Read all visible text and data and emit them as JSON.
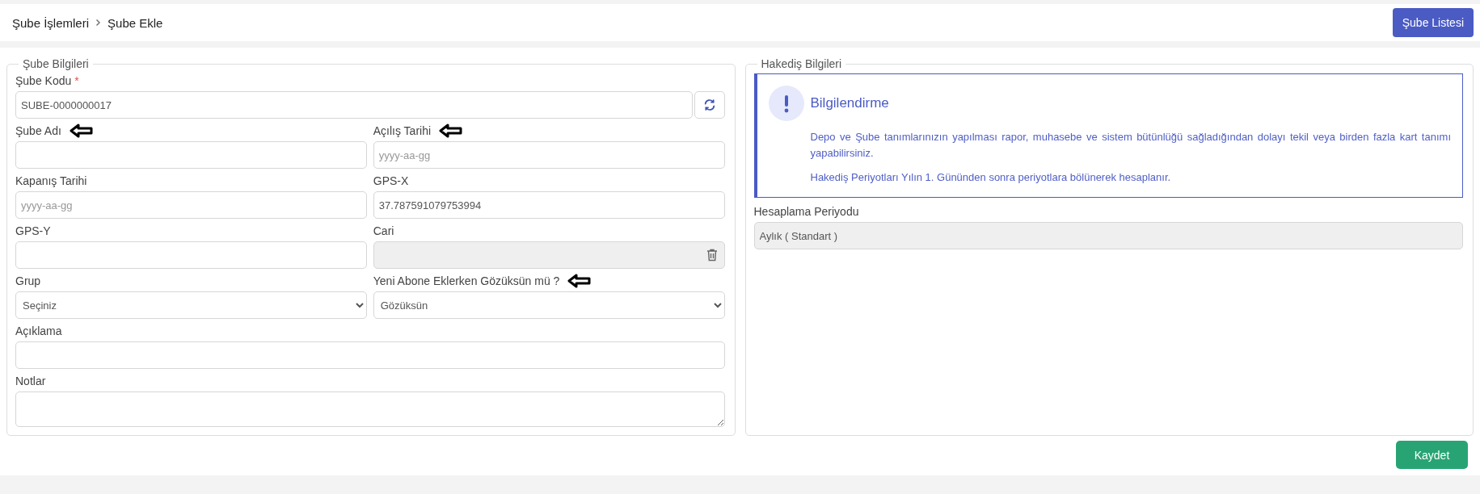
{
  "breadcrumb": {
    "items": [
      "Şube İşlemleri",
      "Şube Ekle"
    ]
  },
  "header_button": "Şube Listesi",
  "branch_section": {
    "legend": "Şube Bilgileri",
    "fields": [
      {
        "label": "Şube Kodu",
        "required_mark": "*",
        "kind": "refresh",
        "value": "SUBE-0000000017",
        "wide": true,
        "arrow_marker": false
      },
      {
        "label": "Şube Adı",
        "kind": "text",
        "wide": false,
        "arrow_marker": true
      },
      {
        "label": "Açılış Tarihi",
        "kind": "text",
        "placeholder": "yyyy-aa-gg",
        "wide": false,
        "arrow_marker": true
      },
      {
        "label": "Kapanış Tarihi",
        "kind": "text",
        "placeholder": "yyyy-aa-gg",
        "wide": false,
        "arrow_marker": false
      },
      {
        "label": "GPS-X",
        "kind": "text",
        "value": "37.787591079753994",
        "wide": false,
        "arrow_marker": false
      },
      {
        "label": "GPS-Y",
        "kind": "text",
        "wide": false,
        "arrow_marker": false
      },
      {
        "label": "Cari",
        "kind": "clearable",
        "disabled": true,
        "wide": false,
        "arrow_marker": false
      },
      {
        "label": "Grup",
        "kind": "select",
        "value": "Seçiniz",
        "wide": false,
        "arrow_marker": false
      },
      {
        "label": "Yeni Abone Eklerken Gözüksün mü ?",
        "kind": "select",
        "value": "Gözüksün",
        "wide": false,
        "arrow_marker": true
      },
      {
        "label": "Açıklama",
        "kind": "text",
        "wide": true,
        "arrow_marker": false
      },
      {
        "label": "Notlar",
        "kind": "textarea",
        "wide": true,
        "arrow_marker": false
      }
    ]
  },
  "earnings_section": {
    "legend": "Hakediş Bilgileri",
    "info": {
      "title": "Bilgilendirme",
      "paragraphs": [
        "Depo ve Şube tanımlarınızın yapılması rapor, muhasebe ve sistem bütünlüğü sağladığından dolayı tekil veya birden fazla kart tanımı yapabilirsiniz.",
        "Hakediş Periyotları Yılın 1. Gününden sonra periyotlara bölünerek hesaplanır."
      ]
    },
    "fields": [
      {
        "label": "Hesaplama Periyodu",
        "kind": "text",
        "value": "Aylık ( Standart )",
        "disabled": true,
        "wide": true
      }
    ]
  },
  "save_button": "Kaydet"
}
